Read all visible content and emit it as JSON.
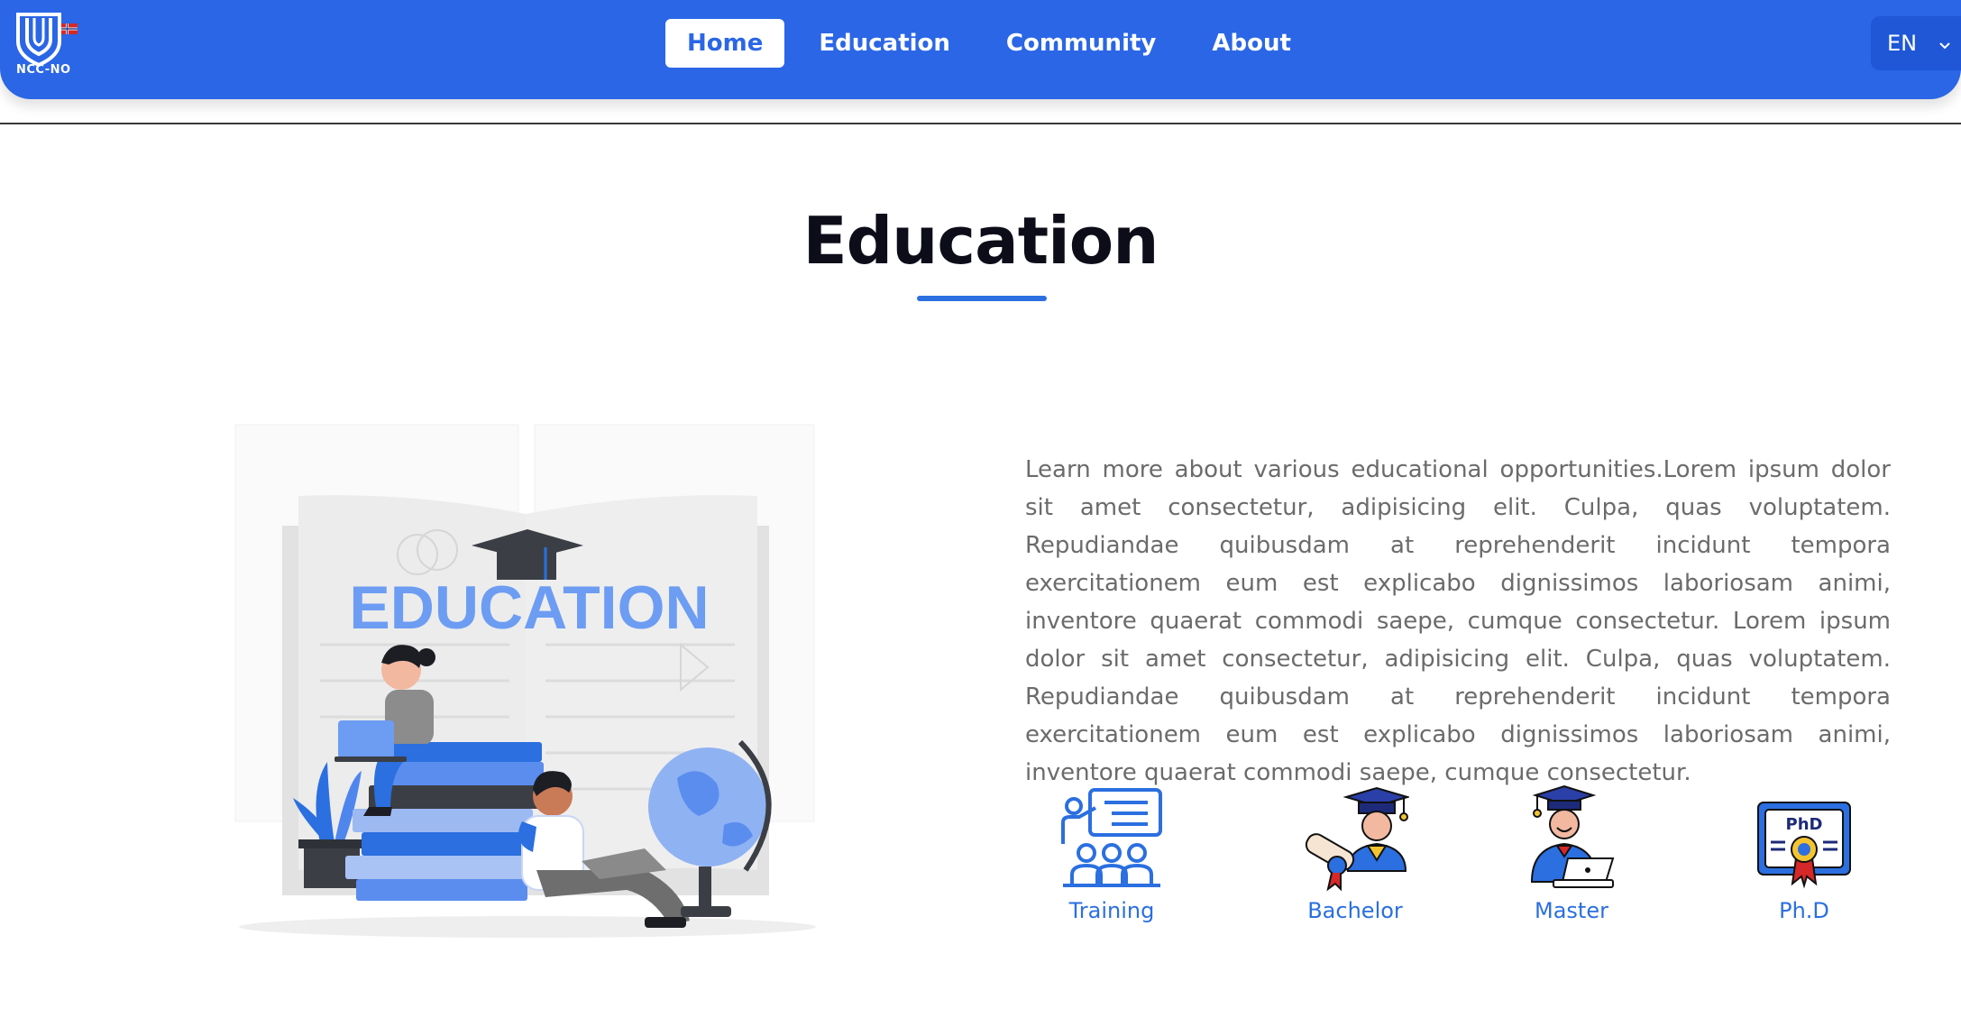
{
  "header": {
    "logo_text": "NCC-NO",
    "nav": [
      {
        "label": "Home",
        "active": true
      },
      {
        "label": "Education",
        "active": false
      },
      {
        "label": "Community",
        "active": false
      },
      {
        "label": "About",
        "active": false
      }
    ],
    "language": "EN",
    "brand_color": "#2b66e6"
  },
  "main": {
    "title": "Education",
    "illustration_text": "EDUCATION",
    "description": "Learn more about various educational opportunities.Lorem ipsum dolor sit amet consectetur, adipisicing elit. Culpa, quas voluptatem. Repudiandae quibusdam at reprehenderit incidunt tempora exercitationem eum est explicabo dignissimos laboriosam animi, inventore quaerat commodi saepe, cumque consectetur. Lorem ipsum dolor sit amet consectetur, adipisicing elit. Culpa, quas voluptatem. Repudiandae quibusdam at reprehenderit incidunt tempora exercitationem eum est explicabo dignissimos laboriosam animi, inventore quaerat commodi saepe, cumque consectetur.",
    "cards": [
      {
        "label": "Training",
        "icon": "training-icon"
      },
      {
        "label": "Bachelor",
        "icon": "bachelor-icon"
      },
      {
        "label": "Master",
        "icon": "master-icon"
      },
      {
        "label": "Ph.D",
        "icon": "phd-icon",
        "badge_text": "PhD"
      }
    ]
  }
}
